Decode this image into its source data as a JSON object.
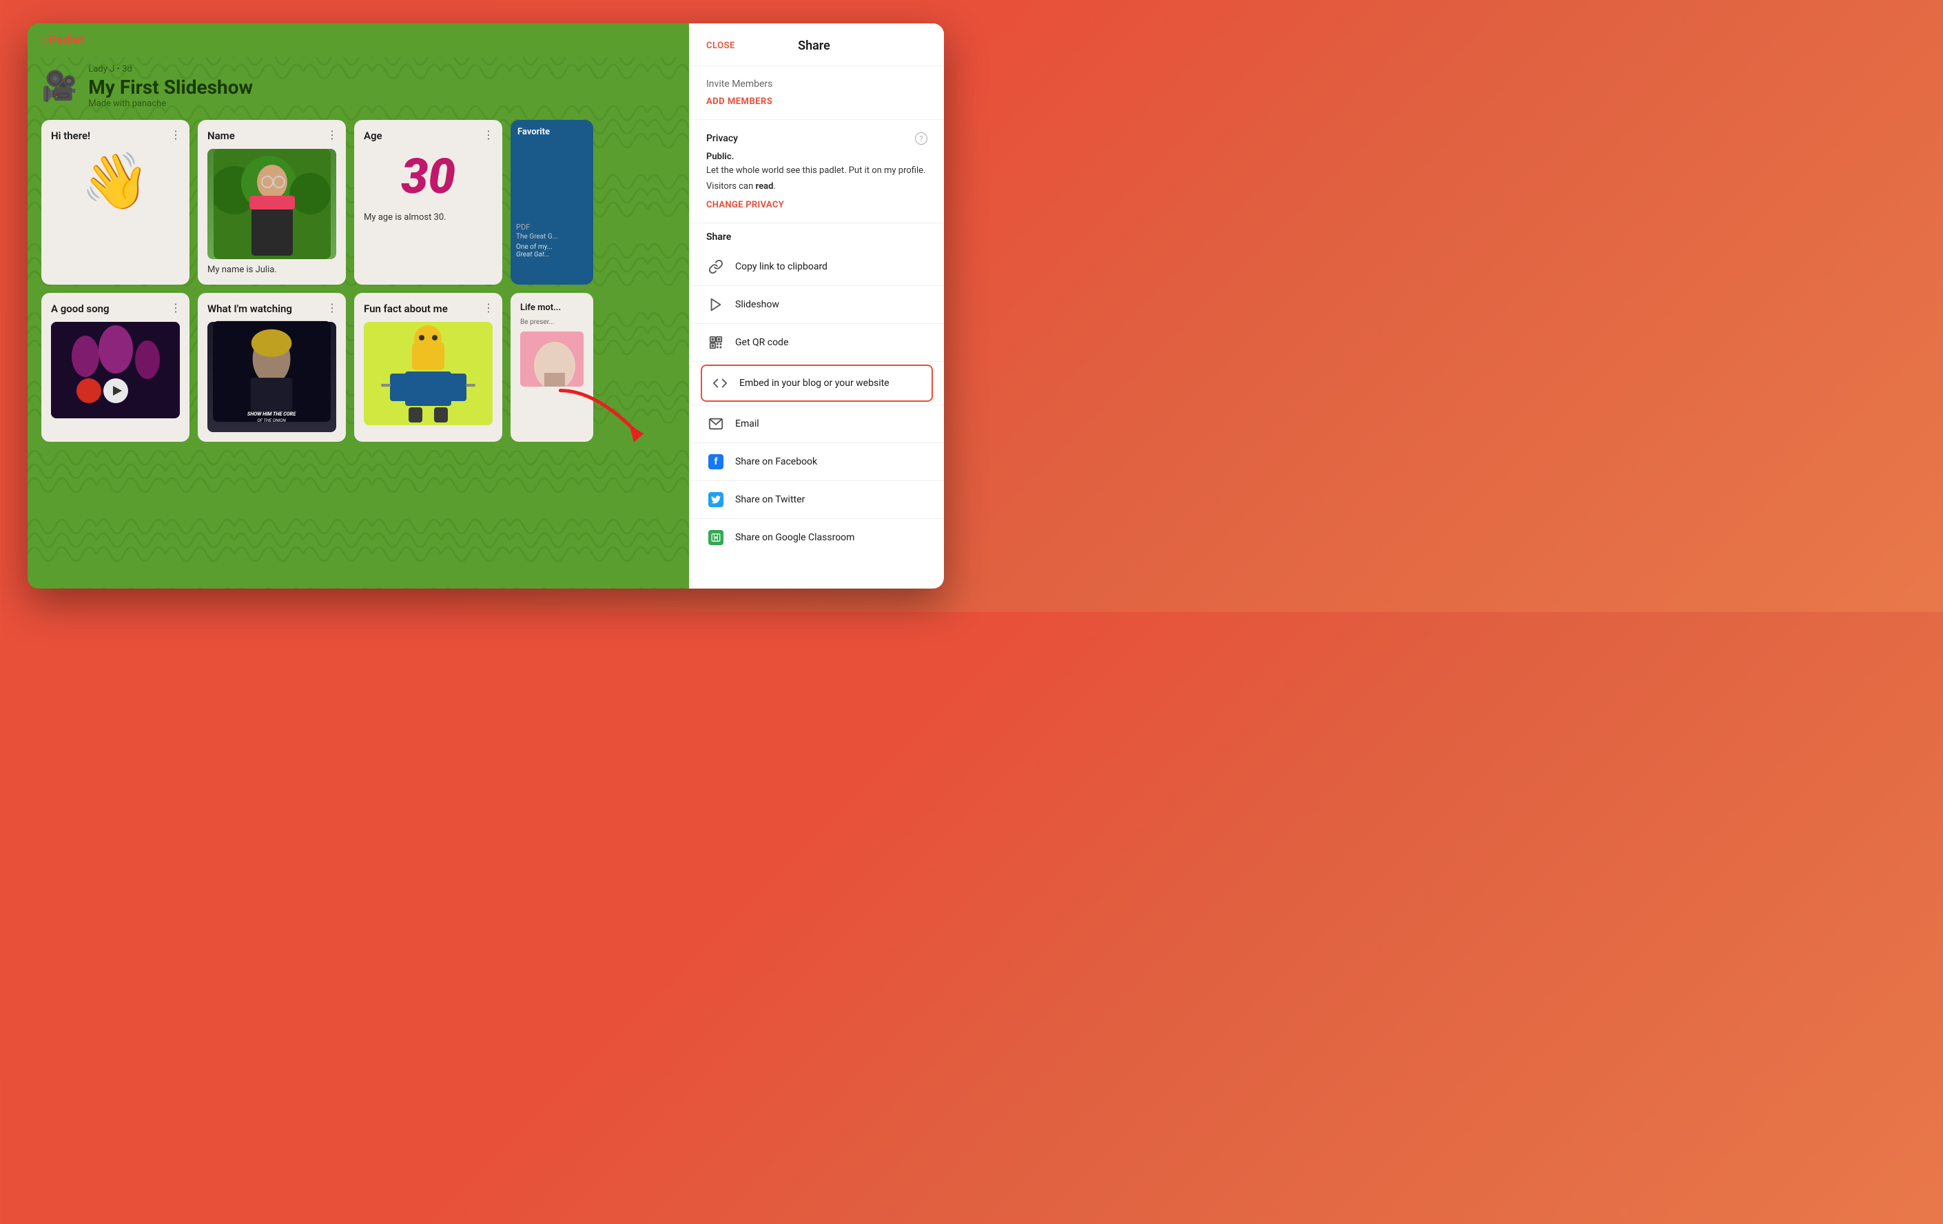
{
  "app": {
    "logo": ":Padlet",
    "window_title": "My First Slideshow - Share"
  },
  "board": {
    "author": "Lady J",
    "time_ago": "3d",
    "title": "My First Slideshow",
    "subtitle": "Made with panache",
    "icon": "🎥"
  },
  "cards": {
    "row1": [
      {
        "id": "hi-there",
        "title": "Hi there!",
        "emoji": "👋",
        "type": "emoji"
      },
      {
        "id": "name",
        "title": "Name",
        "type": "photo",
        "caption": "My name is Julia."
      },
      {
        "id": "age",
        "title": "Age",
        "type": "number",
        "number": "30",
        "caption": "My age is almost 30."
      },
      {
        "id": "favorite-partial",
        "title": "Favorite",
        "type": "partial-blue"
      }
    ],
    "row2": [
      {
        "id": "good-song",
        "title": "A good song",
        "type": "music"
      },
      {
        "id": "watching",
        "title": "What I'm watching",
        "type": "tvshow"
      },
      {
        "id": "fun-fact",
        "title": "Fun fact about me",
        "type": "lego"
      },
      {
        "id": "life-mot-partial",
        "title": "Life mot",
        "type": "partial-pink"
      }
    ]
  },
  "share_panel": {
    "header": {
      "close_label": "CLOSE",
      "title": "Share"
    },
    "sections": {
      "invite_members": {
        "label": "Invite Members",
        "add_members_label": "ADD MEMBERS"
      },
      "privacy": {
        "label": "Privacy",
        "help_icon": "?",
        "status": "Public.",
        "description": "Let the whole world see this padlet. Put it on my profile.",
        "visitors_prefix": "Visitors can ",
        "visitors_permission": "read",
        "visitors_suffix": ".",
        "change_label": "CHANGE PRIVACY"
      },
      "pdf": {
        "label": "PDF",
        "sub": "The Great G..."
      },
      "share": {
        "label": "Share",
        "items": [
          {
            "id": "copy-link",
            "icon": "link",
            "label": "Copy link to clipboard"
          },
          {
            "id": "slideshow",
            "icon": "play",
            "label": "Slideshow"
          },
          {
            "id": "qr-code",
            "icon": "qr",
            "label": "Get QR code"
          },
          {
            "id": "embed",
            "icon": "embed",
            "label": "Embed in your blog or your website",
            "highlighted": true
          },
          {
            "id": "email",
            "icon": "email",
            "label": "Email"
          },
          {
            "id": "facebook",
            "icon": "facebook",
            "label": "Share on Facebook"
          },
          {
            "id": "twitter",
            "icon": "twitter",
            "label": "Share on Twitter"
          },
          {
            "id": "google-classroom",
            "icon": "classroom",
            "label": "Share on Google Classroom"
          }
        ]
      }
    }
  },
  "colors": {
    "accent": "#e8503a",
    "green_bg": "#5a9e2f",
    "twitter_blue": "#1da1f2",
    "facebook_blue": "#1877f2",
    "classroom_green": "#34a853"
  }
}
